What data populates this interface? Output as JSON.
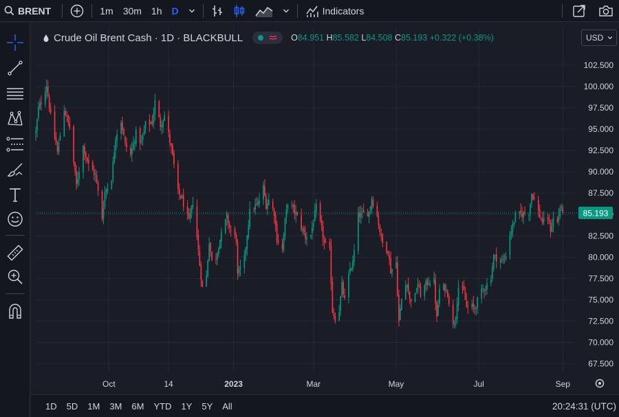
{
  "topbar": {
    "symbol": "BRENT",
    "intervals": [
      "1m",
      "30m",
      "1h",
      "D"
    ],
    "active_interval": "D",
    "indicators_label": "Indicators"
  },
  "legend": {
    "title": "Crude Oil Brent Cash · 1D · BLACKBULL",
    "open_key": "O",
    "open": "84.951",
    "high_key": "H",
    "high": "85.582",
    "low_key": "L",
    "low": "84.508",
    "close_key": "C",
    "close": "85.193",
    "change": "+0.322 (+0.38%)"
  },
  "currency": "USD",
  "price_label": "85.193",
  "ranges": [
    "1D",
    "5D",
    "1M",
    "3M",
    "6M",
    "YTD",
    "1Y",
    "5Y",
    "All"
  ],
  "clock": "20:24:31 (UTC)",
  "colors": {
    "up": "#089981",
    "down": "#f23645",
    "accent": "#2962ff",
    "background": "#1a1c26"
  },
  "left_tools": [
    "crosshair-icon",
    "trend-line-icon",
    "fib-icon",
    "pattern-icon",
    "forecast-icon",
    "brush-icon",
    "text-icon",
    "emoji-icon",
    "ruler-icon",
    "zoom-in-icon",
    "magnet-icon"
  ],
  "chart_data": {
    "type": "candlestick",
    "title": "Crude Oil Brent Cash · 1D · BLACKBULL",
    "y_ticks": [
      67.5,
      70,
      72.5,
      75,
      77.5,
      80,
      82.5,
      85,
      87.5,
      90,
      92.5,
      95,
      97.5,
      100,
      102.5
    ],
    "y_tick_labels": [
      "67.500",
      "70.000",
      "72.500",
      "75.000",
      "77.500",
      "80.000",
      "82.500",
      "85.000",
      "87.500",
      "90.000",
      "92.500",
      "95.000",
      "97.500",
      "100.000",
      "102.500"
    ],
    "x_tick_labels": [
      "Oct",
      "14",
      "2023",
      "Mar",
      "May",
      "Jul",
      "Sep"
    ],
    "x_tick_dates": [
      "2022-10-01",
      "2022-11-14",
      "2023-01-01",
      "2023-03-01",
      "2023-05-01",
      "2023-07-01",
      "2023-09-01"
    ],
    "ylim": [
      66.5,
      104.5
    ],
    "xlim": [
      "2022-08-08",
      "2023-09-10"
    ],
    "last_price": 85.193,
    "grid": true,
    "close_path": [
      [
        "2022-08-08",
        94.6
      ],
      [
        "2022-08-10",
        97.4
      ],
      [
        "2022-08-12",
        98.2
      ],
      [
        "2022-08-16",
        100.2
      ],
      [
        "2022-08-19",
        96.5
      ],
      [
        "2022-08-24",
        92.3
      ],
      [
        "2022-08-29",
        97.4
      ],
      [
        "2022-09-02",
        95.2
      ],
      [
        "2022-09-07",
        88.4
      ],
      [
        "2022-09-12",
        93.0
      ],
      [
        "2022-09-16",
        90.8
      ],
      [
        "2022-09-21",
        89.6
      ],
      [
        "2022-09-26",
        84.6
      ],
      [
        "2022-09-28",
        87.6
      ],
      [
        "2022-10-03",
        89.3
      ],
      [
        "2022-10-06",
        94.2
      ],
      [
        "2022-10-10",
        96.0
      ],
      [
        "2022-10-13",
        93.2
      ],
      [
        "2022-10-17",
        92.0
      ],
      [
        "2022-10-21",
        94.5
      ],
      [
        "2022-10-25",
        93.4
      ],
      [
        "2022-10-28",
        95.6
      ],
      [
        "2022-11-02",
        95.8
      ],
      [
        "2022-11-04",
        98.2
      ],
      [
        "2022-11-08",
        95.5
      ],
      [
        "2022-11-11",
        96.6
      ],
      [
        "2022-11-16",
        92.8
      ],
      [
        "2022-11-21",
        87.6
      ],
      [
        "2022-11-24",
        86.8
      ],
      [
        "2022-11-29",
        84.1
      ],
      [
        "2022-12-02",
        86.5
      ],
      [
        "2022-12-05",
        82.4
      ],
      [
        "2022-12-07",
        79.1
      ],
      [
        "2022-12-09",
        76.4
      ],
      [
        "2022-12-12",
        77.8
      ],
      [
        "2022-12-14",
        81.9
      ],
      [
        "2022-12-16",
        79.5
      ],
      [
        "2022-12-19",
        80.0
      ],
      [
        "2022-12-22",
        82.1
      ],
      [
        "2022-12-27",
        84.7
      ],
      [
        "2022-12-29",
        83.4
      ],
      [
        "2023-01-03",
        82.1
      ],
      [
        "2023-01-04",
        77.8
      ],
      [
        "2023-01-06",
        78.6
      ],
      [
        "2023-01-09",
        79.9
      ],
      [
        "2023-01-11",
        82.7
      ],
      [
        "2023-01-13",
        85.3
      ],
      [
        "2023-01-17",
        86.0
      ],
      [
        "2023-01-19",
        86.2
      ],
      [
        "2023-01-23",
        88.2
      ],
      [
        "2023-01-25",
        86.1
      ],
      [
        "2023-01-27",
        86.7
      ],
      [
        "2023-01-31",
        85.2
      ],
      [
        "2023-02-02",
        82.2
      ],
      [
        "2023-02-06",
        80.9
      ],
      [
        "2023-02-08",
        84.2
      ],
      [
        "2023-02-10",
        86.5
      ],
      [
        "2023-02-14",
        85.6
      ],
      [
        "2023-02-16",
        85.1
      ],
      [
        "2023-02-21",
        83.2
      ],
      [
        "2023-02-23",
        82.4
      ],
      [
        "2023-02-27",
        82.6
      ],
      [
        "2023-03-01",
        84.3
      ],
      [
        "2023-03-03",
        85.8
      ],
      [
        "2023-03-07",
        83.3
      ],
      [
        "2023-03-09",
        81.6
      ],
      [
        "2023-03-13",
        80.8
      ],
      [
        "2023-03-15",
        73.7
      ],
      [
        "2023-03-17",
        72.9
      ],
      [
        "2023-03-20",
        73.8
      ],
      [
        "2023-03-22",
        76.7
      ],
      [
        "2023-03-24",
        74.9
      ],
      [
        "2023-03-28",
        78.6
      ],
      [
        "2023-03-30",
        79.3
      ],
      [
        "2023-04-03",
        84.9
      ],
      [
        "2023-04-06",
        85.0
      ],
      [
        "2023-04-11",
        85.3
      ],
      [
        "2023-04-13",
        86.9
      ],
      [
        "2023-04-17",
        84.8
      ],
      [
        "2023-04-19",
        83.1
      ],
      [
        "2023-04-21",
        81.6
      ],
      [
        "2023-04-25",
        80.8
      ],
      [
        "2023-04-27",
        78.4
      ],
      [
        "2023-05-01",
        79.4
      ],
      [
        "2023-05-03",
        72.4
      ],
      [
        "2023-05-05",
        75.1
      ],
      [
        "2023-05-09",
        77.2
      ],
      [
        "2023-05-11",
        75.0
      ],
      [
        "2023-05-15",
        75.4
      ],
      [
        "2023-05-17",
        76.9
      ],
      [
        "2023-05-19",
        75.6
      ],
      [
        "2023-05-23",
        76.8
      ],
      [
        "2023-05-25",
        77.2
      ],
      [
        "2023-05-29",
        77.1
      ],
      [
        "2023-05-31",
        72.7
      ],
      [
        "2023-06-02",
        76.2
      ],
      [
        "2023-06-06",
        76.4
      ],
      [
        "2023-06-08",
        75.8
      ],
      [
        "2023-06-12",
        72.0
      ],
      [
        "2023-06-14",
        73.3
      ],
      [
        "2023-06-16",
        76.5
      ],
      [
        "2023-06-20",
        75.9
      ],
      [
        "2023-06-22",
        74.1
      ],
      [
        "2023-06-26",
        74.2
      ],
      [
        "2023-06-28",
        74.0
      ],
      [
        "2023-06-30",
        74.9
      ],
      [
        "2023-07-04",
        76.3
      ],
      [
        "2023-07-06",
        76.5
      ],
      [
        "2023-07-10",
        77.7
      ],
      [
        "2023-07-12",
        80.1
      ],
      [
        "2023-07-14",
        79.9
      ],
      [
        "2023-07-18",
        79.6
      ],
      [
        "2023-07-20",
        79.6
      ],
      [
        "2023-07-24",
        82.7
      ],
      [
        "2023-07-26",
        83.6
      ],
      [
        "2023-07-28",
        84.9
      ],
      [
        "2023-08-01",
        85.0
      ],
      [
        "2023-08-03",
        85.1
      ],
      [
        "2023-08-07",
        85.3
      ],
      [
        "2023-08-09",
        87.5
      ],
      [
        "2023-08-11",
        86.8
      ],
      [
        "2023-08-15",
        84.8
      ],
      [
        "2023-08-17",
        84.1
      ],
      [
        "2023-08-21",
        84.5
      ],
      [
        "2023-08-23",
        83.2
      ],
      [
        "2023-08-25",
        84.5
      ],
      [
        "2023-08-28",
        84.1
      ],
      [
        "2023-08-30",
        85.8
      ],
      [
        "2023-09-01",
        85.193
      ]
    ]
  }
}
